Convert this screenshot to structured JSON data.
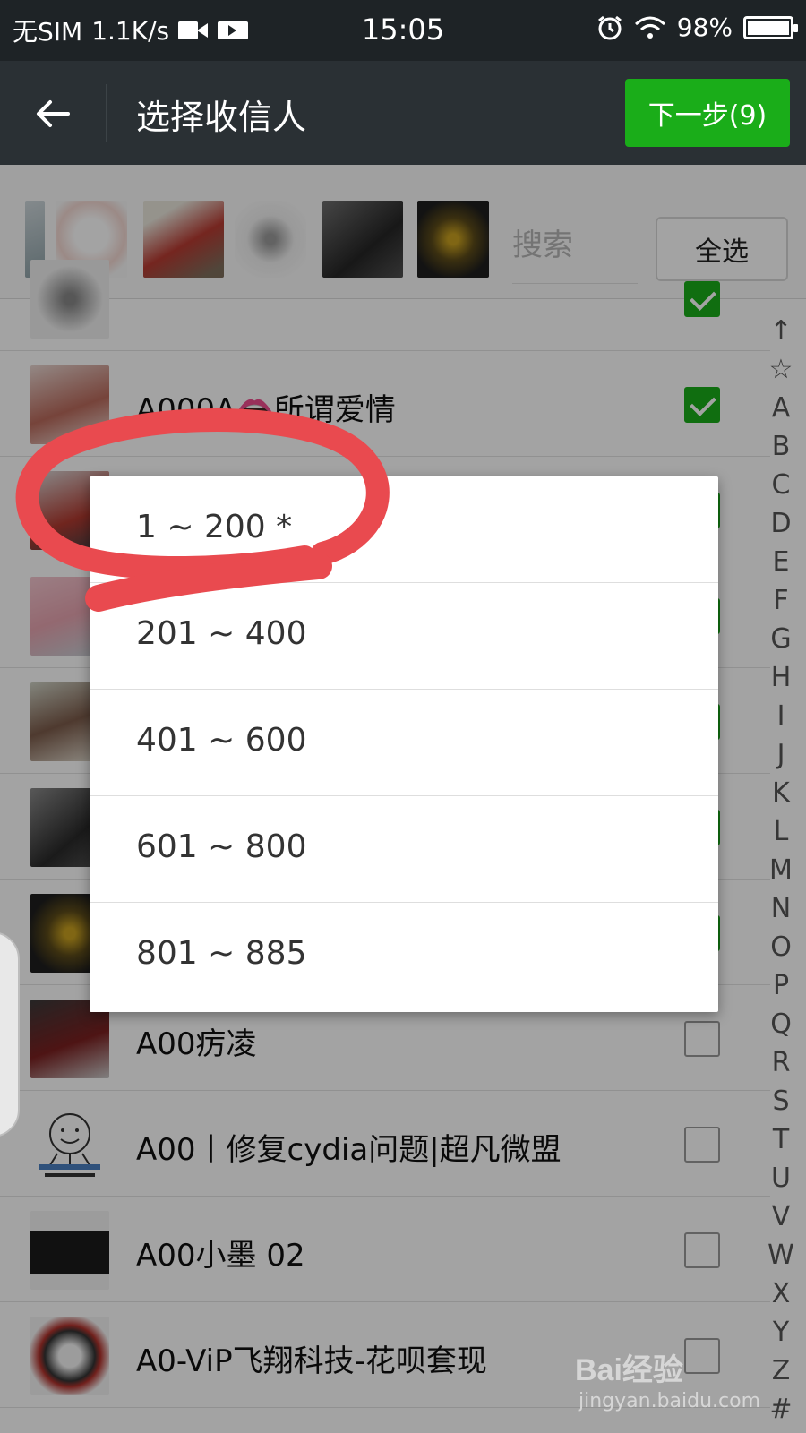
{
  "status_bar": {
    "carrier": "无SIM",
    "speed": "1.1K/s",
    "time": "15:05",
    "battery": "98%"
  },
  "app_bar": {
    "title": "选择收信人",
    "next_button": "下一步(9)"
  },
  "selected_strip": {
    "search_placeholder": "搜索",
    "select_all": "全选"
  },
  "contacts": [
    {
      "name": "A000A👄所谓爱情",
      "checked": true
    },
    {
      "name": "",
      "checked": true
    },
    {
      "name": "",
      "checked": true
    },
    {
      "name": "",
      "checked": true
    },
    {
      "name": "",
      "checked": true
    },
    {
      "name": "",
      "checked": true
    },
    {
      "name": "A00疠凌",
      "checked": false
    },
    {
      "name": "A00丨修复cydia问题|超凡微盟",
      "checked": false
    },
    {
      "name": "A00小墨 02",
      "checked": false
    },
    {
      "name": "A0-ViP飞翔科技-花呗套现",
      "checked": false
    }
  ],
  "index_letters": [
    "↑",
    "☆",
    "A",
    "B",
    "C",
    "D",
    "E",
    "F",
    "G",
    "H",
    "I",
    "J",
    "K",
    "L",
    "M",
    "N",
    "O",
    "P",
    "Q",
    "R",
    "S",
    "T",
    "U",
    "V",
    "W",
    "X",
    "Y",
    "Z",
    "#"
  ],
  "range_popup": {
    "items": [
      "1 ~ 200  *",
      "201 ~ 400",
      "401 ~ 600",
      "601 ~ 800",
      "801 ~ 885"
    ]
  },
  "watermark": {
    "logo": "Bai经验",
    "url": "jingyan.baidu.com"
  },
  "colors": {
    "accent_green": "#1aad19",
    "annotation_red": "#e94a4f"
  }
}
